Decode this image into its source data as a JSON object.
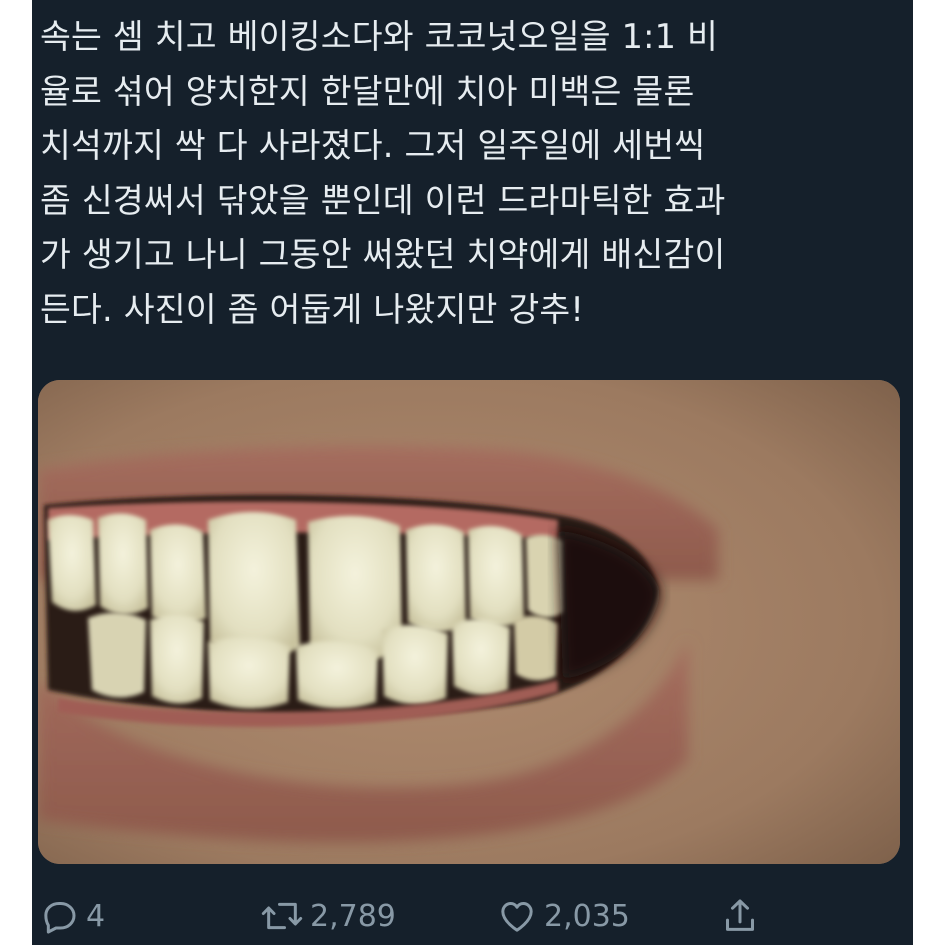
{
  "tweet": {
    "lines": [
      "속는 셈 치고 베이킹소다와 코코넛오일을 1:1 비",
      "율로 섞어 양치한지 한달만에 치아 미백은 물론",
      "치석까지 싹 다 사라졌다. 그저 일주일에 세번씩",
      "좀 신경써서 닦았을 뿐인데 이런 드라마틱한 효과",
      "가 생기고 나니 그동안 써왔던 치약에게 배신감이",
      "든다. 사진이 좀 어둡게 나왔지만 강추!"
    ]
  },
  "actions": {
    "reply": {
      "icon": "reply-icon",
      "count": "4"
    },
    "retweet": {
      "icon": "retweet-icon",
      "count": "2,789"
    },
    "like": {
      "icon": "heart-icon",
      "count": "2,035"
    },
    "share": {
      "icon": "share-icon"
    }
  },
  "colors": {
    "background": "#15202b",
    "text": "#e6ecf0",
    "secondary": "#8899a6"
  }
}
